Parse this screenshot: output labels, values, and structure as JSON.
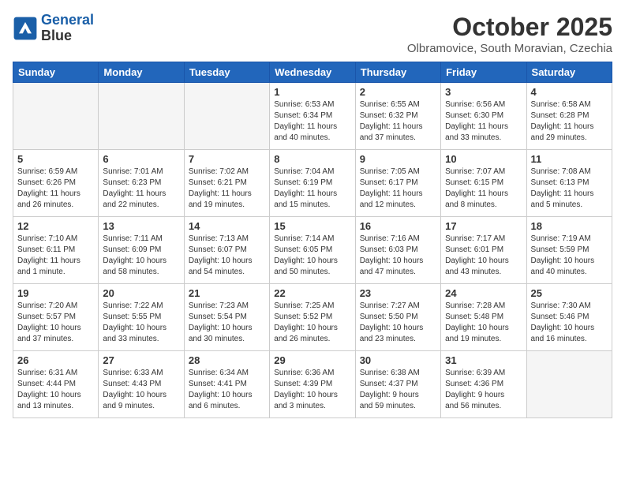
{
  "header": {
    "logo_line1": "General",
    "logo_line2": "Blue",
    "month_title": "October 2025",
    "location": "Olbramovice, South Moravian, Czechia"
  },
  "weekdays": [
    "Sunday",
    "Monday",
    "Tuesday",
    "Wednesday",
    "Thursday",
    "Friday",
    "Saturday"
  ],
  "weeks": [
    [
      {
        "day": "",
        "info": ""
      },
      {
        "day": "",
        "info": ""
      },
      {
        "day": "",
        "info": ""
      },
      {
        "day": "1",
        "info": "Sunrise: 6:53 AM\nSunset: 6:34 PM\nDaylight: 11 hours\nand 40 minutes."
      },
      {
        "day": "2",
        "info": "Sunrise: 6:55 AM\nSunset: 6:32 PM\nDaylight: 11 hours\nand 37 minutes."
      },
      {
        "day": "3",
        "info": "Sunrise: 6:56 AM\nSunset: 6:30 PM\nDaylight: 11 hours\nand 33 minutes."
      },
      {
        "day": "4",
        "info": "Sunrise: 6:58 AM\nSunset: 6:28 PM\nDaylight: 11 hours\nand 29 minutes."
      }
    ],
    [
      {
        "day": "5",
        "info": "Sunrise: 6:59 AM\nSunset: 6:26 PM\nDaylight: 11 hours\nand 26 minutes."
      },
      {
        "day": "6",
        "info": "Sunrise: 7:01 AM\nSunset: 6:23 PM\nDaylight: 11 hours\nand 22 minutes."
      },
      {
        "day": "7",
        "info": "Sunrise: 7:02 AM\nSunset: 6:21 PM\nDaylight: 11 hours\nand 19 minutes."
      },
      {
        "day": "8",
        "info": "Sunrise: 7:04 AM\nSunset: 6:19 PM\nDaylight: 11 hours\nand 15 minutes."
      },
      {
        "day": "9",
        "info": "Sunrise: 7:05 AM\nSunset: 6:17 PM\nDaylight: 11 hours\nand 12 minutes."
      },
      {
        "day": "10",
        "info": "Sunrise: 7:07 AM\nSunset: 6:15 PM\nDaylight: 11 hours\nand 8 minutes."
      },
      {
        "day": "11",
        "info": "Sunrise: 7:08 AM\nSunset: 6:13 PM\nDaylight: 11 hours\nand 5 minutes."
      }
    ],
    [
      {
        "day": "12",
        "info": "Sunrise: 7:10 AM\nSunset: 6:11 PM\nDaylight: 11 hours\nand 1 minute."
      },
      {
        "day": "13",
        "info": "Sunrise: 7:11 AM\nSunset: 6:09 PM\nDaylight: 10 hours\nand 58 minutes."
      },
      {
        "day": "14",
        "info": "Sunrise: 7:13 AM\nSunset: 6:07 PM\nDaylight: 10 hours\nand 54 minutes."
      },
      {
        "day": "15",
        "info": "Sunrise: 7:14 AM\nSunset: 6:05 PM\nDaylight: 10 hours\nand 50 minutes."
      },
      {
        "day": "16",
        "info": "Sunrise: 7:16 AM\nSunset: 6:03 PM\nDaylight: 10 hours\nand 47 minutes."
      },
      {
        "day": "17",
        "info": "Sunrise: 7:17 AM\nSunset: 6:01 PM\nDaylight: 10 hours\nand 43 minutes."
      },
      {
        "day": "18",
        "info": "Sunrise: 7:19 AM\nSunset: 5:59 PM\nDaylight: 10 hours\nand 40 minutes."
      }
    ],
    [
      {
        "day": "19",
        "info": "Sunrise: 7:20 AM\nSunset: 5:57 PM\nDaylight: 10 hours\nand 37 minutes."
      },
      {
        "day": "20",
        "info": "Sunrise: 7:22 AM\nSunset: 5:55 PM\nDaylight: 10 hours\nand 33 minutes."
      },
      {
        "day": "21",
        "info": "Sunrise: 7:23 AM\nSunset: 5:54 PM\nDaylight: 10 hours\nand 30 minutes."
      },
      {
        "day": "22",
        "info": "Sunrise: 7:25 AM\nSunset: 5:52 PM\nDaylight: 10 hours\nand 26 minutes."
      },
      {
        "day": "23",
        "info": "Sunrise: 7:27 AM\nSunset: 5:50 PM\nDaylight: 10 hours\nand 23 minutes."
      },
      {
        "day": "24",
        "info": "Sunrise: 7:28 AM\nSunset: 5:48 PM\nDaylight: 10 hours\nand 19 minutes."
      },
      {
        "day": "25",
        "info": "Sunrise: 7:30 AM\nSunset: 5:46 PM\nDaylight: 10 hours\nand 16 minutes."
      }
    ],
    [
      {
        "day": "26",
        "info": "Sunrise: 6:31 AM\nSunset: 4:44 PM\nDaylight: 10 hours\nand 13 minutes."
      },
      {
        "day": "27",
        "info": "Sunrise: 6:33 AM\nSunset: 4:43 PM\nDaylight: 10 hours\nand 9 minutes."
      },
      {
        "day": "28",
        "info": "Sunrise: 6:34 AM\nSunset: 4:41 PM\nDaylight: 10 hours\nand 6 minutes."
      },
      {
        "day": "29",
        "info": "Sunrise: 6:36 AM\nSunset: 4:39 PM\nDaylight: 10 hours\nand 3 minutes."
      },
      {
        "day": "30",
        "info": "Sunrise: 6:38 AM\nSunset: 4:37 PM\nDaylight: 9 hours\nand 59 minutes."
      },
      {
        "day": "31",
        "info": "Sunrise: 6:39 AM\nSunset: 4:36 PM\nDaylight: 9 hours\nand 56 minutes."
      },
      {
        "day": "",
        "info": ""
      }
    ]
  ]
}
